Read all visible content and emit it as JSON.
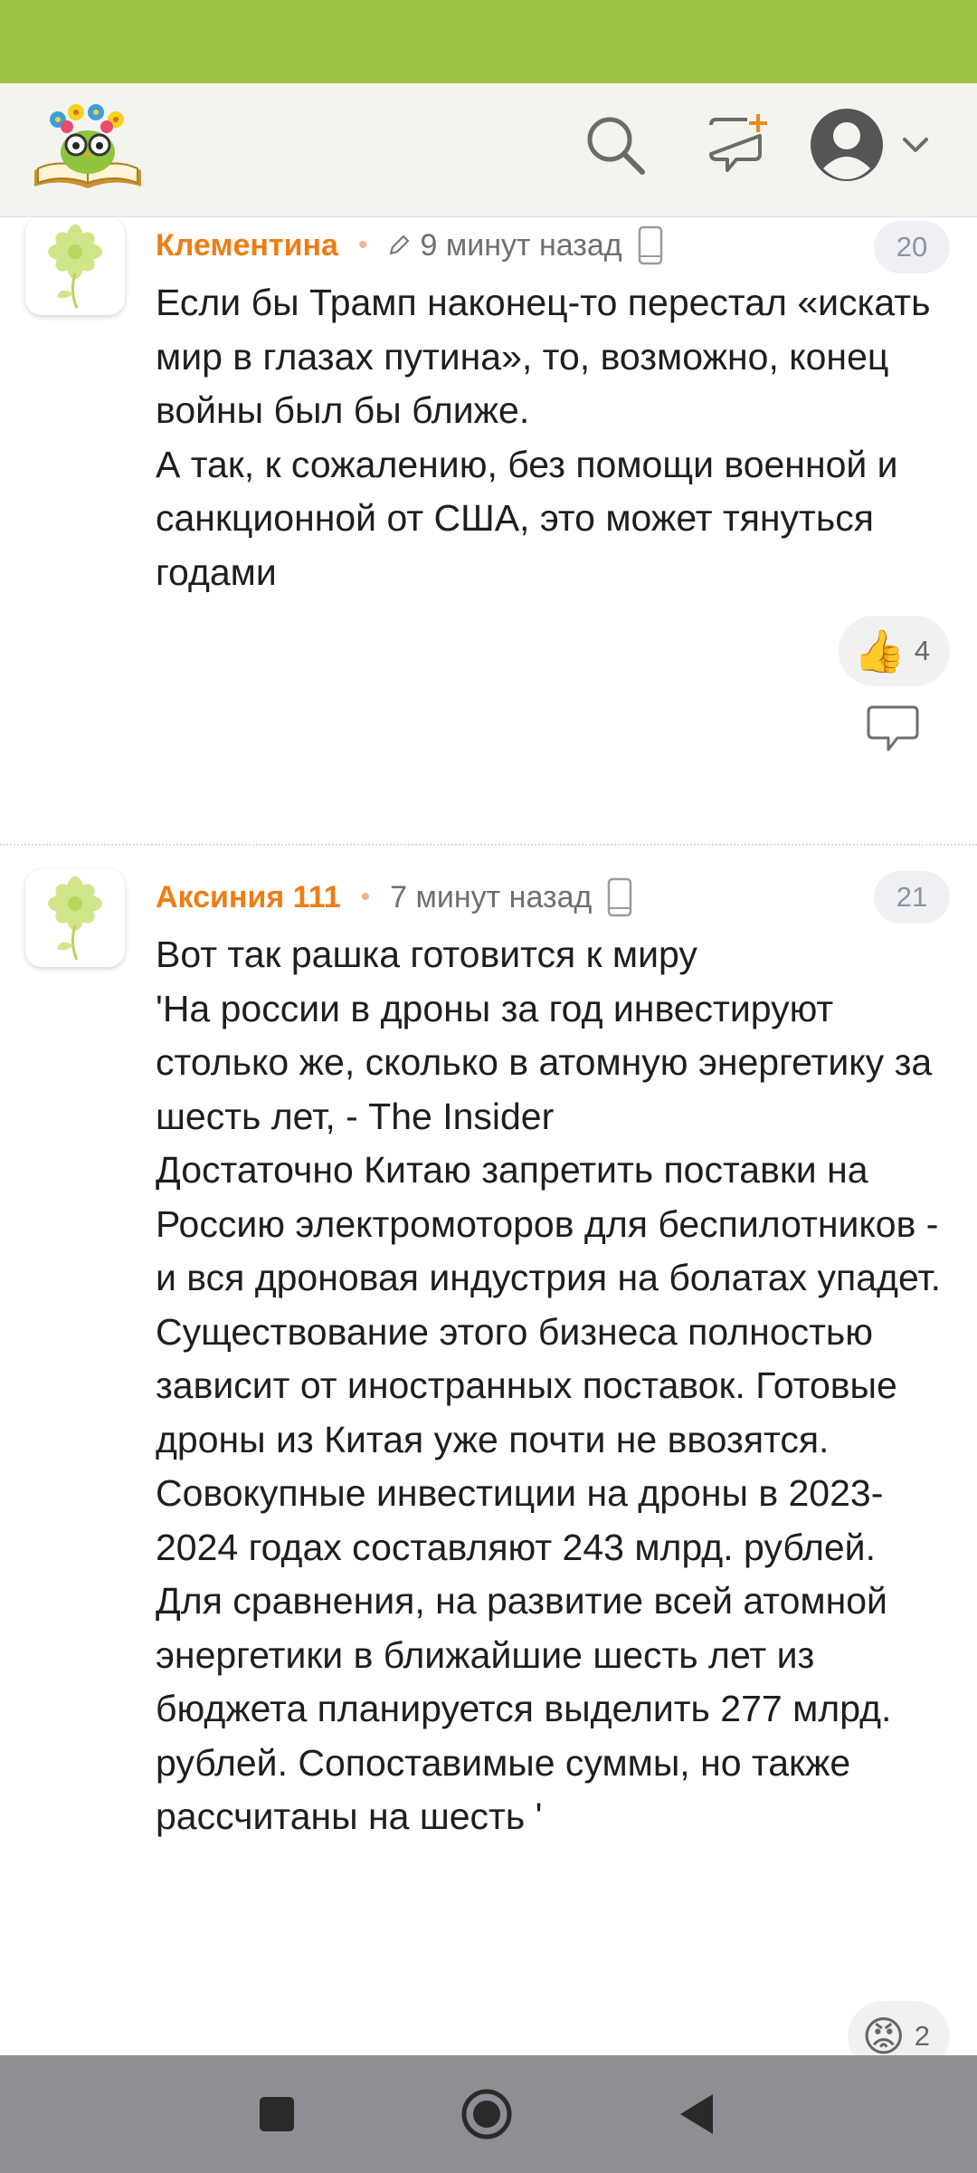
{
  "header": {
    "logo": "reading-owl-logo",
    "search_icon": "search-icon",
    "comments_icon": "new-comment-icon",
    "profile_icon": "user-avatar-icon"
  },
  "comments": [
    {
      "author": "Клементина",
      "time": "9 минут назад",
      "edited": true,
      "number": "20",
      "text": "Если бы Трамп наконец-то перестал «искать мир в глазах путина», то, возможно, конец войны был бы ближе.\nА так, к сожалению, без помощи военной и санкционной от США, это может тянуться годами",
      "reaction": {
        "emoji": "👍",
        "count": "4"
      }
    },
    {
      "author": "Аксиния 111",
      "time": "7 минут назад",
      "edited": false,
      "number": "21",
      "text": "Вот так рашка готовится к миру\n'На россии в дроны за год инвестируют столько же, сколько в атомную энергетику за шесть лет, - The Insider\nДостаточно Китаю запретить поставки на Россию электромоторов для беспилотников - и вся дроновая индустрия на болатах упадет. Существование этого бизнеса полностью зависит от иностранных поставок. Готовые дроны из Китая уже почти не ввозятся.\nСовокупные инвестиции на дроны в 2023-2024 годах составляют 243 млрд. рублей. Для сравнения, на развитие всей атомной энергетики в ближайшие шесть лет из бюджета планируется выделить 277 млрд. рублей. Сопоставимые суммы, но также рассчитаны на шесть '",
      "reaction": {
        "emoji": "😡",
        "count": "2"
      }
    }
  ],
  "colors": {
    "status_bar": "#9dc145",
    "author": "#ef7d14",
    "nav_bar": "#8e8e94"
  },
  "navbar": {
    "recent_icon": "square-recent-apps-icon",
    "home_icon": "circle-home-icon",
    "back_icon": "triangle-back-icon"
  }
}
